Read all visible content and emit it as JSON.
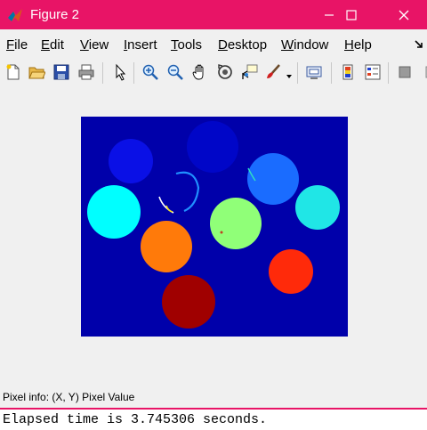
{
  "window": {
    "title": "Figure 2",
    "title_bar_color": "#e81466"
  },
  "menubar": {
    "items": [
      {
        "prefix": "",
        "accel": "F",
        "rest": "ile"
      },
      {
        "prefix": "",
        "accel": "E",
        "rest": "dit"
      },
      {
        "prefix": "",
        "accel": "V",
        "rest": "iew"
      },
      {
        "prefix": "",
        "accel": "I",
        "rest": "nsert"
      },
      {
        "prefix": "",
        "accel": "T",
        "rest": "ools"
      },
      {
        "prefix": "",
        "accel": "D",
        "rest": "esktop"
      },
      {
        "prefix": "",
        "accel": "W",
        "rest": "indow"
      },
      {
        "prefix": "",
        "accel": "H",
        "rest": "elp"
      }
    ]
  },
  "toolbar": {
    "icons": [
      "new-figure-icon",
      "open-file-icon",
      "save-figure-icon",
      "print-figure-icon",
      "edit-plot-arrow-icon",
      "zoom-in-icon",
      "zoom-out-icon",
      "pan-hand-icon",
      "rotate-3d-icon",
      "data-cursor-icon",
      "brush-icon",
      "link-plot-icon",
      "insert-colorbar-icon",
      "insert-legend-icon",
      "hide-plot-tools-icon"
    ]
  },
  "figure": {
    "background_color": "#0000aa",
    "blobs": [
      {
        "label": "blob-1",
        "color": "#0a10e6"
      },
      {
        "label": "blob-2",
        "color": "#0006c8"
      },
      {
        "label": "blob-3",
        "color": "#1a6cff"
      },
      {
        "label": "blob-4",
        "color": "#00ffff"
      },
      {
        "label": "blob-5",
        "color": "#20e6e6"
      },
      {
        "label": "blob-6",
        "color": "#90ff78"
      },
      {
        "label": "blob-7",
        "color": "#ff7a0a"
      },
      {
        "label": "blob-8",
        "color": "#ff2a0a"
      },
      {
        "label": "blob-9",
        "color": "#a00000"
      }
    ]
  },
  "status": {
    "pixel_info": "Pixel info: (X, Y)  Pixel Value"
  },
  "console": {
    "text": "Elapsed time is 3.745306 seconds."
  }
}
